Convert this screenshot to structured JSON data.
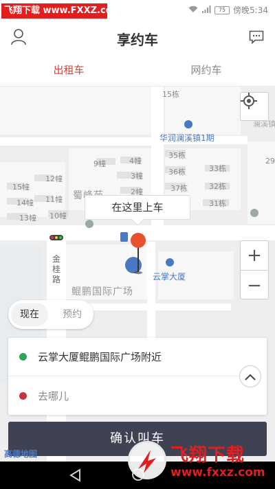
{
  "statusbar": {
    "watermark": "飞翔下载 www.FXXZ.com",
    "battery": "75",
    "time": "傍晚5:34"
  },
  "header": {
    "title": "享约车"
  },
  "tabs": [
    {
      "label": "出租车",
      "active": true
    },
    {
      "label": "网约车",
      "active": false
    }
  ],
  "map": {
    "labels": {
      "b15": "15栋",
      "huarun": "华润澜溪镇1期",
      "lanxi": "澜溪镇",
      "b35": "35栋",
      "b36": "36栋",
      "b33": "33栋",
      "b37": "37栋",
      "b32": "32栋",
      "b31": "31栋",
      "b29": "29",
      "h9": "9幢",
      "h4": "4幢",
      "h12": "12幢",
      "h3": "3幢",
      "h15": "15幢",
      "h14": "14幢",
      "h11": "11幢",
      "h2": "2幢",
      "h13": "13幢",
      "h10": "10幢",
      "shuyuan": "蜀峰苑",
      "road": "金桂路",
      "plaza": "鲲鹏国际广场",
      "yunzhang": "云掌大厦"
    },
    "pickup_tip": "在这里上车",
    "zoom_in": "+",
    "zoom_out": "−",
    "brand": "高德地图"
  },
  "time_toggle": {
    "now": "现在",
    "reserve": "预约"
  },
  "address": {
    "from": "云掌大厦鲲鹏国际广场附近",
    "to_placeholder": "去哪儿"
  },
  "confirm_label": "确认叫车",
  "watermark_bottom": {
    "big": "飞翔下载",
    "small": "www.fxxz.com"
  }
}
